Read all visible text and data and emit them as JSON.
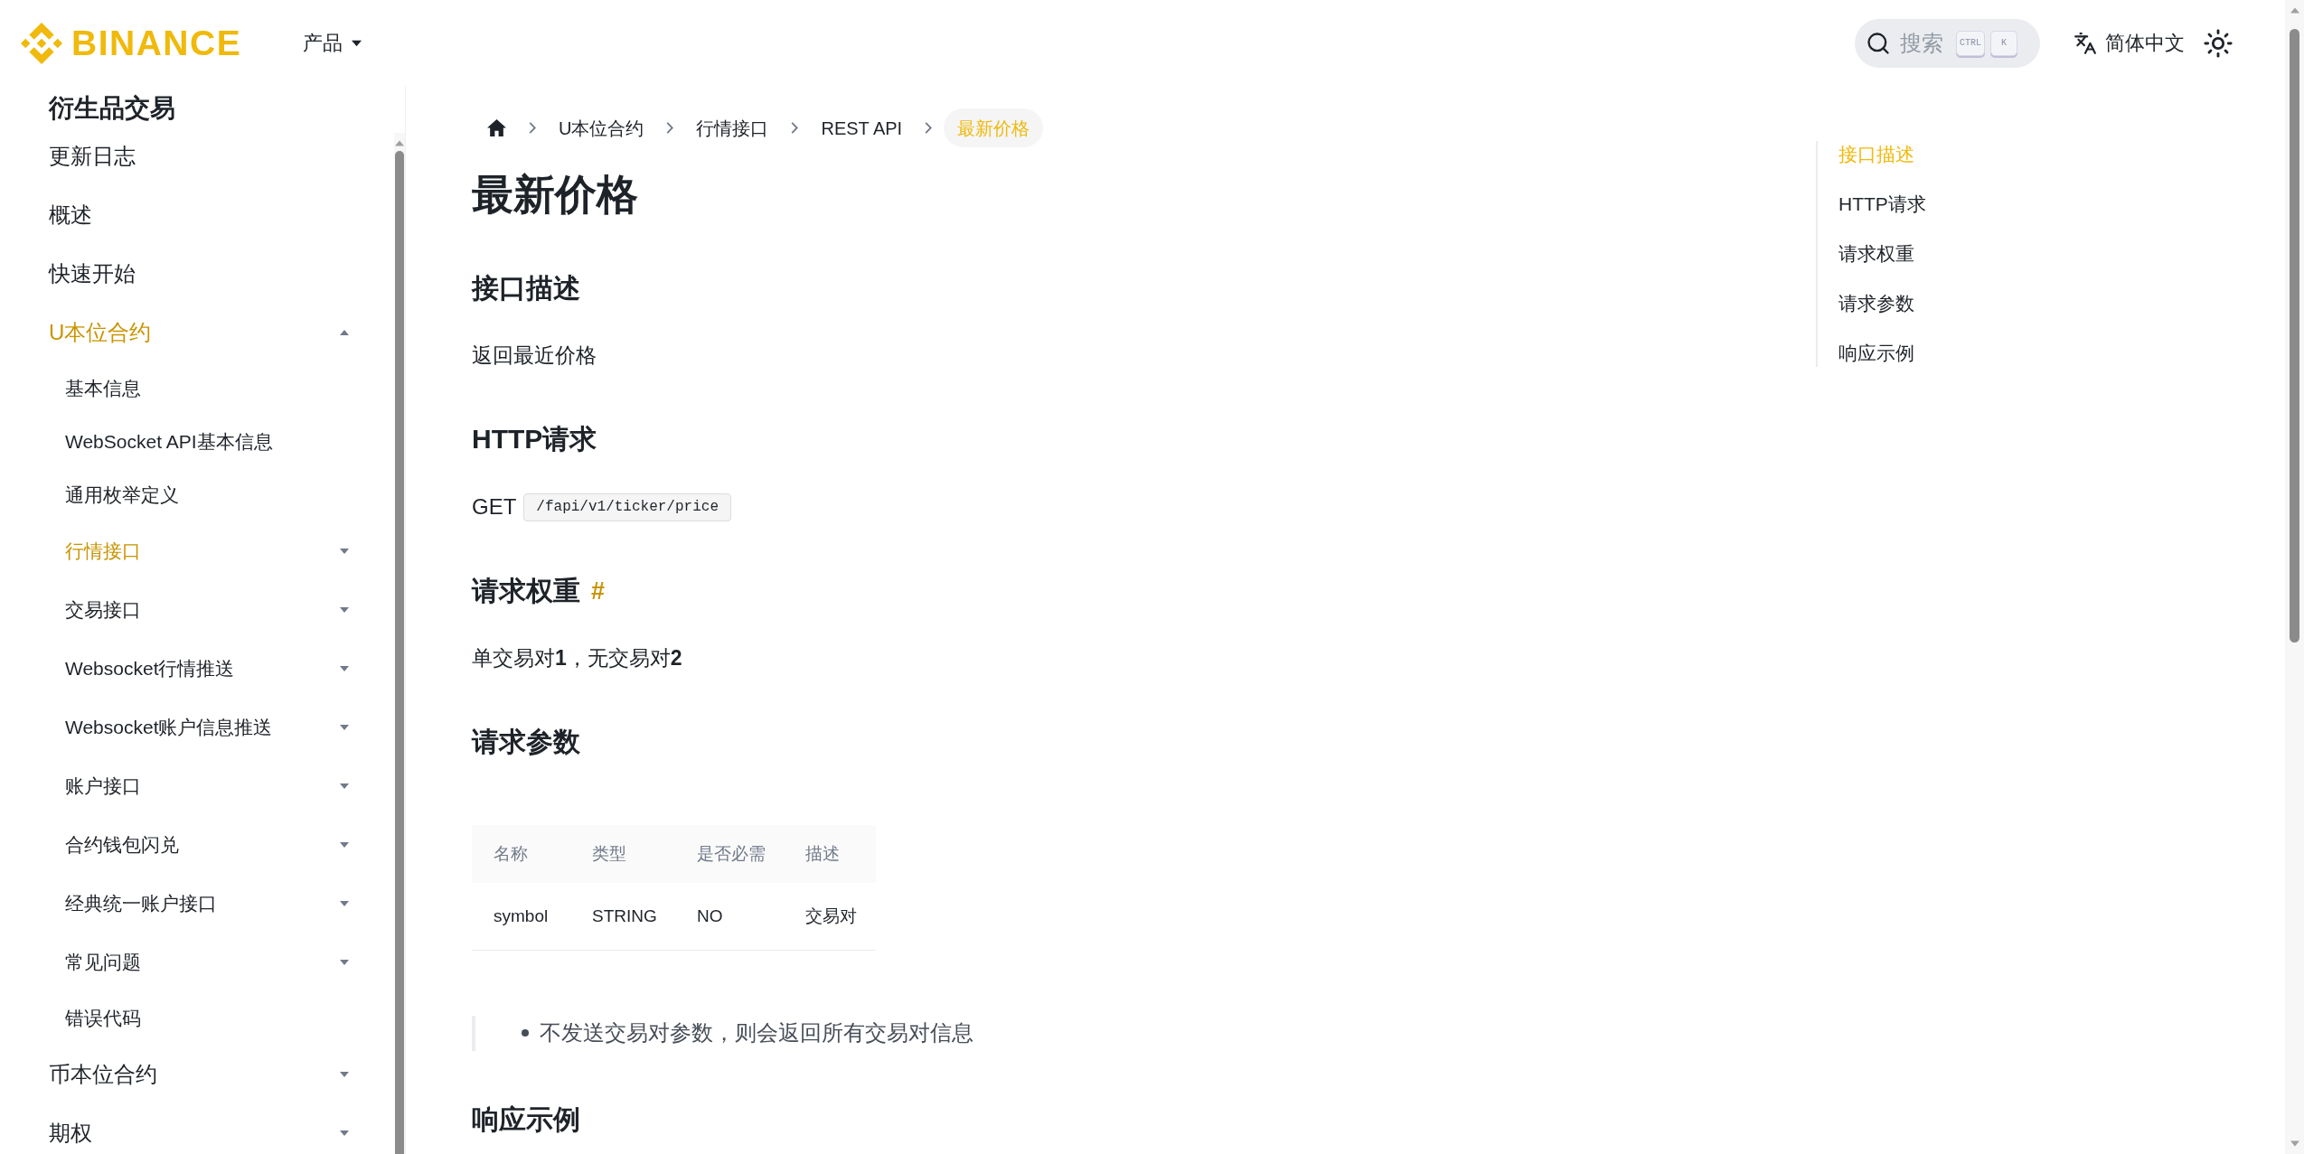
{
  "header": {
    "logo": "BINANCE",
    "nav": [
      {
        "label": "产品",
        "expanded": false
      }
    ],
    "search": {
      "placeholder": "搜索",
      "keys": [
        "CTRL",
        "K"
      ]
    },
    "language": "简体中文"
  },
  "sidebar": {
    "title": "衍生品交易",
    "items": [
      {
        "label": "更新日志",
        "selected": false
      },
      {
        "label": "概述",
        "selected": false
      },
      {
        "label": "快速开始",
        "selected": false
      },
      {
        "label": "U本位合约",
        "selected": true,
        "expanded": true,
        "children": [
          {
            "label": "基本信息",
            "selected": false
          },
          {
            "label": "WebSocket API基本信息",
            "selected": false
          },
          {
            "label": "通用枚举定义",
            "selected": false
          },
          {
            "label": "行情接口",
            "selected": true,
            "expanded": false
          },
          {
            "label": "交易接口",
            "selected": false,
            "expanded": false
          },
          {
            "label": "Websocket行情推送",
            "selected": false,
            "expanded": false
          },
          {
            "label": "Websocket账户信息推送",
            "selected": false,
            "expanded": false
          },
          {
            "label": "账户接口",
            "selected": false,
            "expanded": false
          },
          {
            "label": "合约钱包闪兑",
            "selected": false,
            "expanded": false
          },
          {
            "label": "经典统一账户接口",
            "selected": false,
            "expanded": false
          },
          {
            "label": "常见问题",
            "selected": false,
            "expanded": false
          },
          {
            "label": "错误代码",
            "selected": false
          }
        ]
      },
      {
        "label": "币本位合约",
        "selected": false,
        "expanded": false
      },
      {
        "label": "期权",
        "selected": false,
        "expanded": false
      }
    ]
  },
  "breadcrumb": [
    {
      "label": "U本位合约",
      "selected": false
    },
    {
      "label": "行情接口",
      "selected": false
    },
    {
      "label": "REST API",
      "selected": false
    },
    {
      "label": "最新价格",
      "selected": true
    }
  ],
  "article": {
    "title": "最新价格",
    "sections": [
      {
        "heading": "接口描述",
        "blocks": [
          {
            "kind": "paragraph",
            "text": "返回最近价格"
          }
        ]
      },
      {
        "heading": "HTTP请求",
        "blocks": [
          {
            "kind": "endpoint",
            "method": "GET",
            "path": "/fapi/v1/ticker/price"
          }
        ]
      },
      {
        "heading": "请求权重",
        "anchor": "#",
        "blocks": [
          {
            "kind": "paragraph",
            "text": "单交易对**1**，无交易对**2**"
          }
        ]
      },
      {
        "heading": "请求参数",
        "blocks": [
          {
            "kind": "table",
            "columns": [
              "名称",
              "类型",
              "是否必需",
              "描述"
            ],
            "rows": [
              [
                "symbol",
                "STRING",
                "NO",
                "交易对"
              ]
            ]
          },
          {
            "kind": "note",
            "items": [
              "不发送交易对参数，则会返回所有交易对信息"
            ]
          }
        ]
      },
      {
        "heading": "响应示例"
      }
    ]
  },
  "toc": [
    {
      "label": "接口描述",
      "selected": true
    },
    {
      "label": "HTTP请求",
      "selected": false
    },
    {
      "label": "请求权重",
      "selected": false
    },
    {
      "label": "请求参数",
      "selected": false
    },
    {
      "label": "响应示例",
      "selected": false
    }
  ]
}
